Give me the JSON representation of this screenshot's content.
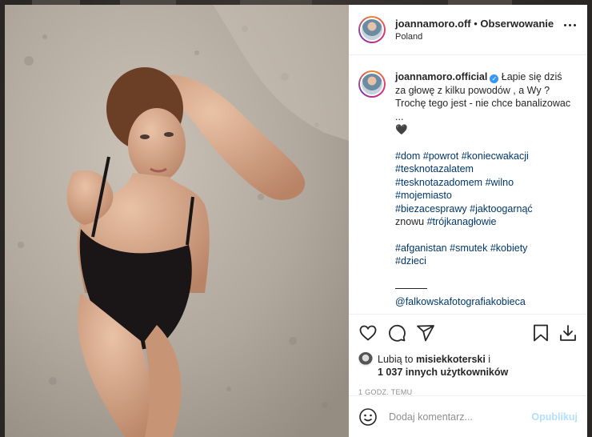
{
  "post": {
    "username": "joannamoro.off",
    "follow_separator": " • ",
    "follow_label": "Obserwowanie",
    "location": "Poland",
    "more_icon": "more-horizontal-icon"
  },
  "caption": {
    "author": "joannamoro.official",
    "verified_icon": "verified-badge-icon",
    "verified_glyph": "✓",
    "text": " Łapie się dziś za głowę z kilku powodów , a Wy ? Trochę tego jest - nie chce banalizowac ...",
    "heart": "🖤",
    "tags_line1": [
      "#dom",
      "#powrot",
      "#koniecwakacji",
      "#tesknotazalatem",
      "#tesknotazadomem",
      "#wilno",
      "#mojemiasto",
      "#biezacesprawy",
      "#jaktoogarnąć"
    ],
    "znowu": "znowu ",
    "tag_trojka": "#trójkanagłowie",
    "tags_line2": [
      "#afganistan",
      "#smutek",
      "#kobiety",
      "#dzieci"
    ],
    "mention": "@falkowskafotografiakobieca"
  },
  "actions": {
    "like_icon": "heart-icon",
    "comment_icon": "comment-icon",
    "share_icon": "share-icon",
    "save_icon": "bookmark-icon",
    "download_icon": "download-icon"
  },
  "likes": {
    "prefix": "Lubią to ",
    "user": "misiekkoterski",
    "middle": " i",
    "count": "1 037 innych użytkowników"
  },
  "time": "1 GODZ. TEMU",
  "comment": {
    "placeholder": "Dodaj komentarz...",
    "post_label": "Opublikuj",
    "emoji_icon": "emoji-icon"
  },
  "colors": {
    "link": "#00376b",
    "verified": "#3897f0",
    "post_disabled": "#b2dffc"
  }
}
